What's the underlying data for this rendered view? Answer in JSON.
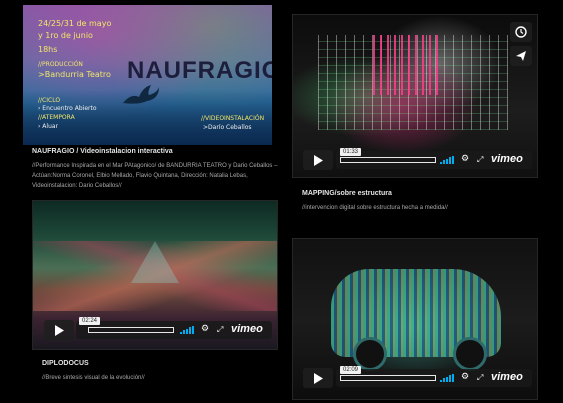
{
  "poster": {
    "dates": "24/25/31 de mayo",
    "dates2": "y 1ro de junio",
    "time": "18hs",
    "production_label": "//PRODUCCIÓN",
    "company": ">Bandurria Teatro",
    "title": "NAUFRAGIO",
    "cast_label": "//CICLO",
    "cast1": "› Encuentro Abierto",
    "cast2_label": "//ATEMPORA",
    "cast2": "› Aluar",
    "credit_label": "//VIDEOINSTALACIÓN",
    "credit": ">Darío Ceballos"
  },
  "items": [
    {
      "title": "NAUFRAGIO / Videoinstalacion interactiva",
      "desc": "//Performance Inspirada en el Mar PAtagonico/ de BANDURRIA TEATRO y Dario Ceballos – Actúan:Norma Coronel, Elbio Mellado, Flavio Quintana, Dirección: Natalia Lebas, Videoinstalacion: Dario Ceballos//"
    },
    {
      "title": "MAPPING/sobre estructura",
      "desc": "//intervencion digital sobre estructura hecha a medida//",
      "time": "01:33",
      "brand": "vimeo"
    },
    {
      "title": "DIPLODOCUS",
      "desc": "//Breve sintesis visual de la evolución//",
      "time": "02:24",
      "brand": "vimeo"
    },
    {
      "title": "",
      "desc": "",
      "time": "02:09",
      "brand": "vimeo"
    }
  ],
  "icons": {
    "clock": "clock-icon",
    "send": "send-icon",
    "play": "play-icon",
    "gear": "gear-icon",
    "fullscreen": "fullscreen-icon",
    "volume": "volume-icon"
  },
  "colors": {
    "accent": "#00adef",
    "background": "#000000"
  }
}
